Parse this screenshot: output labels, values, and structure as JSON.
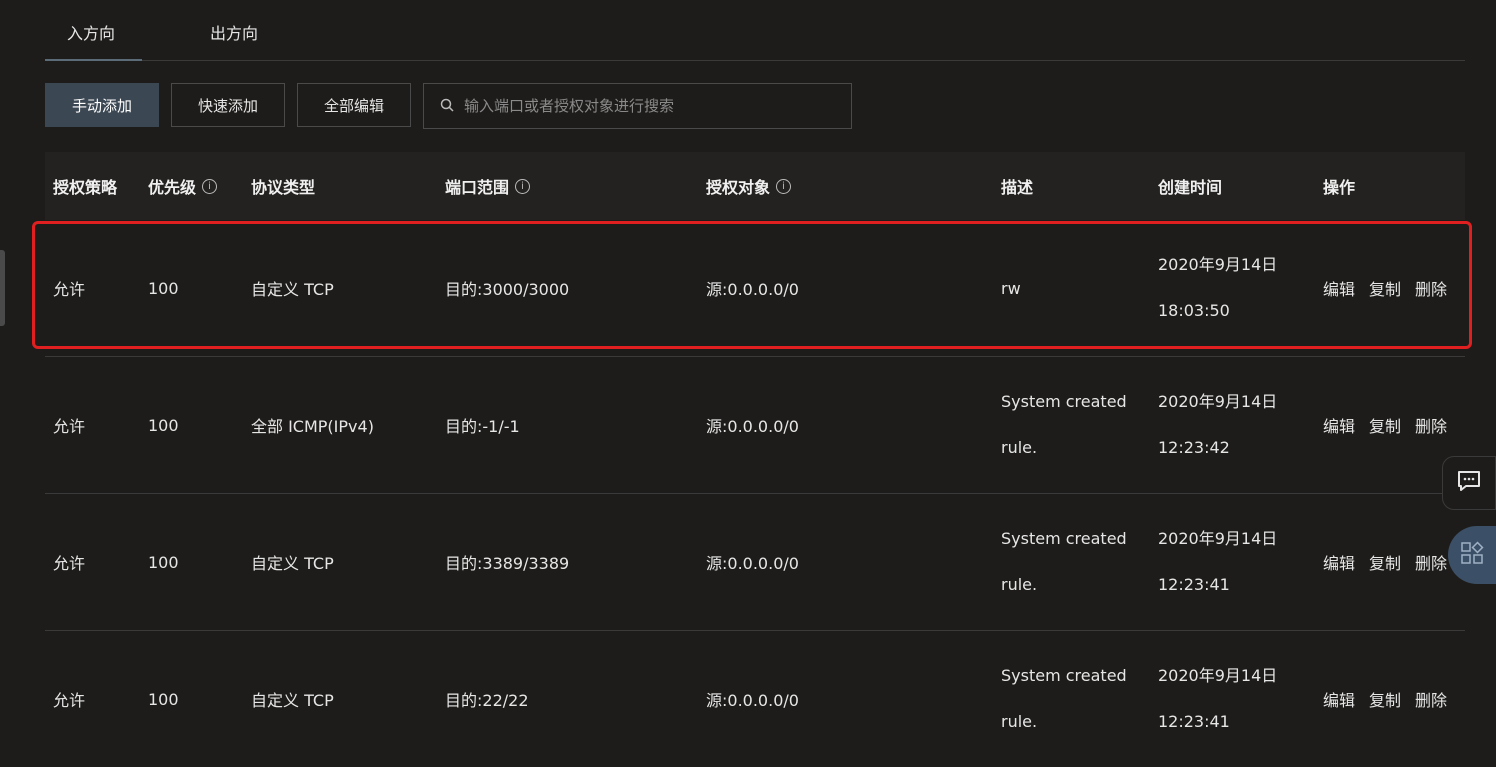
{
  "tabs": [
    {
      "label": "入方向",
      "active": true
    },
    {
      "label": "出方向",
      "active": false
    }
  ],
  "toolbar": {
    "manual_add": "手动添加",
    "quick_add": "快速添加",
    "edit_all": "全部编辑",
    "search_placeholder": "输入端口或者授权对象进行搜索",
    "search_value": ""
  },
  "table": {
    "headers": [
      "授权策略",
      "优先级",
      "协议类型",
      "端口范围",
      "授权对象",
      "描述",
      "创建时间",
      "操作"
    ],
    "rows": [
      {
        "policy": "允许",
        "priority": "100",
        "protocol": "自定义 TCP",
        "port": "目的:3000/3000",
        "object": "源:0.0.0.0/0",
        "desc1": "rw",
        "desc2": "",
        "date": "2020年9月14日",
        "time": "18:03:50",
        "highlighted": true
      },
      {
        "policy": "允许",
        "priority": "100",
        "protocol": "全部 ICMP(IPv4)",
        "port": "目的:-1/-1",
        "object": "源:0.0.0.0/0",
        "desc1": "System created",
        "desc2": "rule.",
        "date": "2020年9月14日",
        "time": "12:23:42",
        "highlighted": false
      },
      {
        "policy": "允许",
        "priority": "100",
        "protocol": "自定义 TCP",
        "port": "目的:3389/3389",
        "object": "源:0.0.0.0/0",
        "desc1": "System created",
        "desc2": "rule.",
        "date": "2020年9月14日",
        "time": "12:23:41",
        "highlighted": false
      },
      {
        "policy": "允许",
        "priority": "100",
        "protocol": "自定义 TCP",
        "port": "目的:22/22",
        "object": "源:0.0.0.0/0",
        "desc1": "System created",
        "desc2": "rule.",
        "date": "2020年9月14日",
        "time": "12:23:41",
        "highlighted": false
      }
    ],
    "actions": {
      "edit": "编辑",
      "copy": "复制",
      "delete": "删除"
    }
  },
  "icons": {
    "search": "search-icon",
    "info": "info-icon",
    "chat": "chat-icon",
    "apps": "apps-icon"
  },
  "colors": {
    "highlight": "#e02020",
    "primary_button": "#3b4753",
    "background": "#1d1c1a"
  }
}
